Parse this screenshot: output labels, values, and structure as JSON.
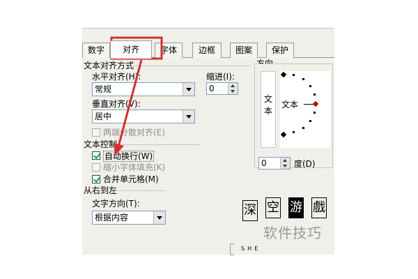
{
  "tabs": [
    "数字",
    "对齐",
    "字体",
    "边框",
    "图案",
    "保护"
  ],
  "alignment": {
    "section_title": "文本对齐方式",
    "horizontal_label": "水平对齐(H):",
    "horizontal_value": "常规",
    "indent_label": "缩进(I):",
    "indent_value": "0",
    "vertical_label": "垂直对齐(V):",
    "vertical_value": "居中",
    "justify_distributed_label": "两端分散对齐(E)"
  },
  "text_control": {
    "section_title": "文本控制",
    "wrap_text_label": "自动换行(W)",
    "wrap_text_checked": true,
    "shrink_label": "缩小字体填充(K)",
    "shrink_checked": false,
    "merge_label": "合并单元格(M)",
    "merge_checked": true
  },
  "rtl": {
    "section_title": "从右到左",
    "direction_label": "文字方向(T):",
    "direction_value": "根据内容"
  },
  "orientation": {
    "section_title": "方向",
    "vertical_text": "文本",
    "dial_text": "文本",
    "degree_value": "0",
    "degree_label": "度(D)"
  },
  "watermark": {
    "logo_chars": [
      "深",
      "空",
      "游",
      "戲"
    ],
    "caption": "软件技巧",
    "sub": "SHE"
  },
  "colors": {
    "annotation": "#d0312d"
  }
}
